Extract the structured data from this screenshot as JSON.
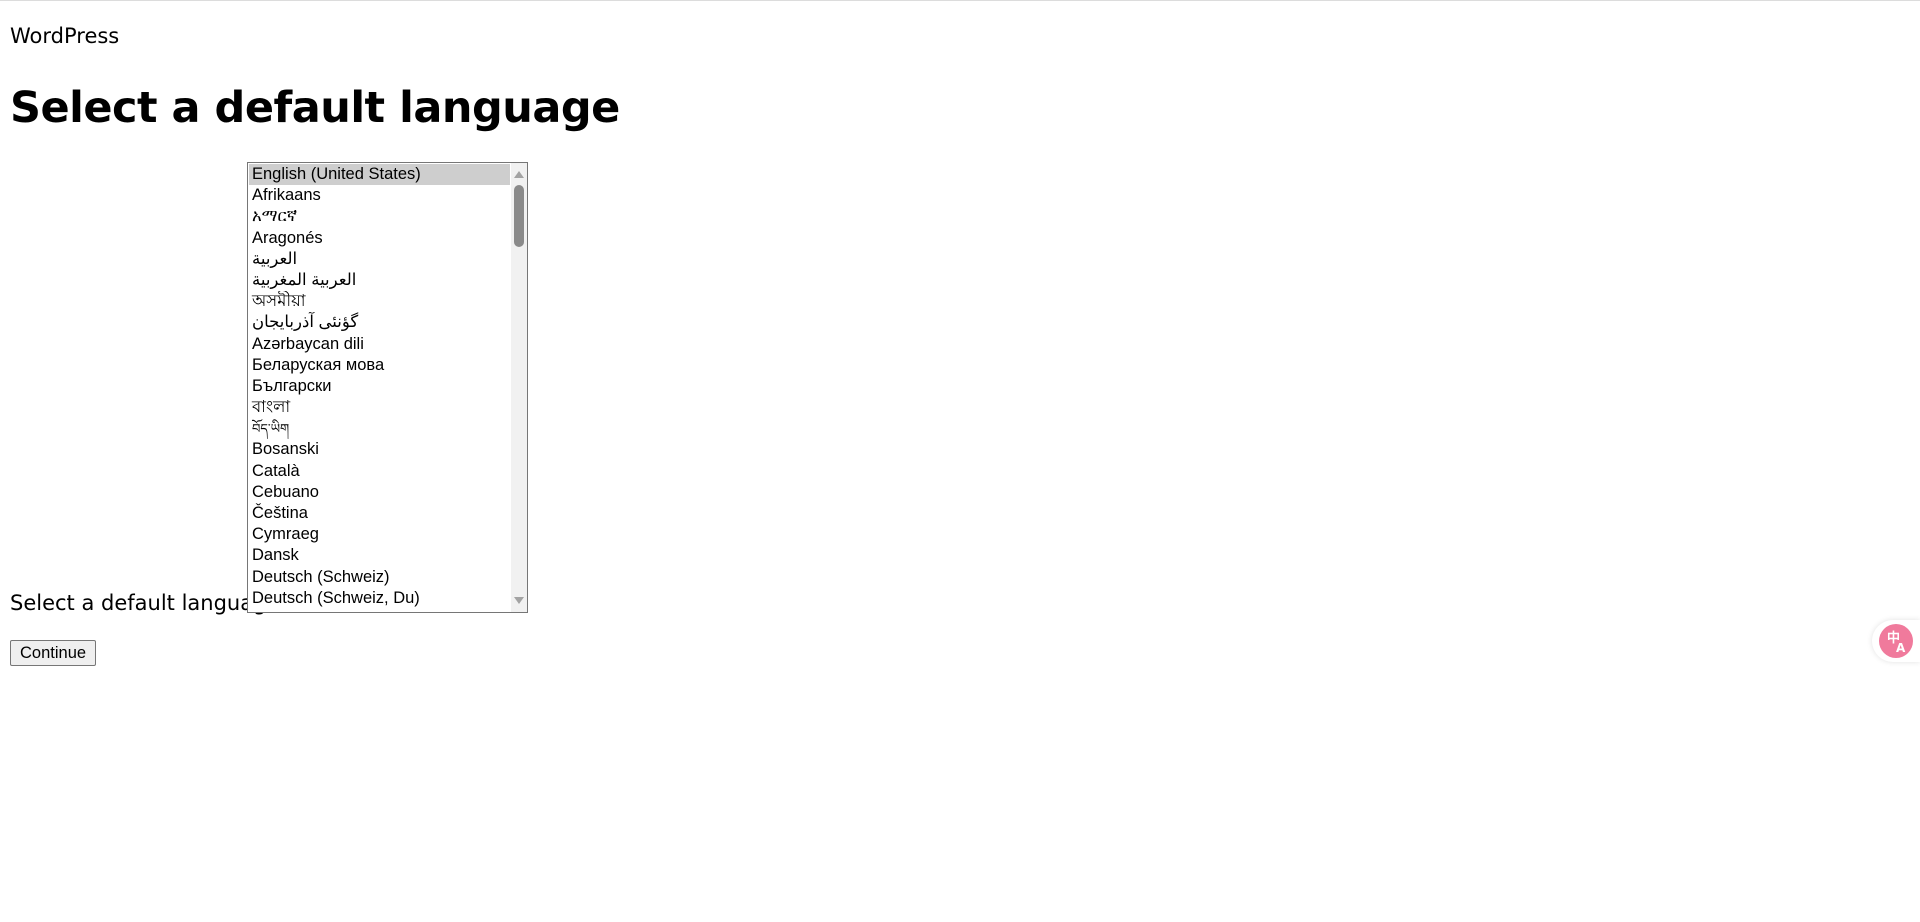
{
  "site": {
    "name": "WordPress"
  },
  "page": {
    "title": "Select a default language"
  },
  "language_select": {
    "label": "Select a default language",
    "selected": "English (United States)",
    "options": [
      "English (United States)",
      "Afrikaans",
      "አማርኛ",
      "Aragonés",
      "العربية",
      "العربية المغربية",
      "অসমীয়া",
      "گؤنئی آذربایجان",
      "Azərbaycan dili",
      "Беларуская мова",
      "Български",
      "বাংলা",
      "བོད་ཡིག",
      "Bosanski",
      "Català",
      "Cebuano",
      "Čeština",
      "Cymraeg",
      "Dansk",
      "Deutsch (Schweiz)",
      "Deutsch (Schweiz, Du)"
    ]
  },
  "actions": {
    "continue_label": "Continue"
  },
  "widgets": {
    "translate_icon": "translate-icon",
    "translate_color": "#f07a9c"
  }
}
